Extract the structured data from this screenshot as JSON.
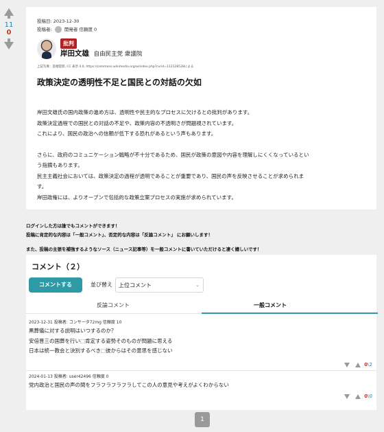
{
  "votes": {
    "up": "11",
    "down": "0"
  },
  "post": {
    "date_label": "投稿日: 2023-12-30",
    "author_label": "投稿者:",
    "author_name": "開発者",
    "trust_label": "信頼度 0",
    "tag": "批判",
    "politician_name": "岸田文雄",
    "politician_party": "自由民主党 衆議院",
    "photo_credit": "上記写真：首相官邸, CC 表示 4.0, https://commons.wikimedia.org/w/index.php?curid=112128528による",
    "title": "政策決定の透明性不足と国民との対話の欠如",
    "body_lines": [
      "岸田文雄氏の国内政策の進め方は、透明性や民主的なプロセスに欠けるとの批判があります。",
      "政策決定過程での国民との対話の不足や、政策内容の不透明さが問題視されています。",
      "これにより、国民の政治への信頼が低下する恐れがあるという声もあります。",
      "さらに、政府のコミュニケーション戦略が不十分であるため、国民が政策の意図や内容を理解しにくくなっているとい",
      "う指摘もあります。",
      "民主主義社会においては、政策決定の過程が透明であることが重要であり、国民の声を反映させることが求められま",
      "す。",
      "岸田政権には、よりオープンで包括的な政策立案プロセスの実施が求められています。"
    ]
  },
  "notices": [
    "ログインした方は誰でもコメントができます！",
    "投稿に肯定的な内容は「一般コメント」、否定的な内容は「反論コメント」 にお願いします！",
    "また、投稿の主張を補強するようなソース（ニュース記事等）を一般コメントに書いていただけると凄く嬉しいです！"
  ],
  "comments_section": {
    "heading": "コメント（２）",
    "comment_button": "コメントする",
    "sort_label": "並び替え",
    "sort_selected": "上位コメント",
    "tabs": [
      "反論コメント",
      "一般コメント"
    ],
    "active_tab": "一般コメント",
    "items": [
      {
        "meta": "2023-12-31 投稿者: コンサータ72mg 信頼度 10",
        "lines": [
          "黒葬儀に対する説明はいつするのか？",
          "安倍晋三の国葬を行い⬚肯定する姿勢そのものが問題に思える",
          "日本は統一教会と決別するべき⬚彼からはその意思を感じない"
        ],
        "up_count": "0",
        "sep": "\\",
        "down_count": "2"
      },
      {
        "meta": "2024-01-13 投稿者: user42496 信頼度 0",
        "lines": [
          "党内政治と国民の声の間をフラフラフラフラしてこの人の意見や考えがよくわからない"
        ],
        "up_count": "0",
        "sep": "\\",
        "down_count": "0"
      }
    ]
  },
  "pagination": {
    "current": "1"
  },
  "colors": {
    "accent": "#2d9aa6",
    "tag": "#b22222",
    "up": "#2a7da3",
    "down": "#c0392b"
  }
}
